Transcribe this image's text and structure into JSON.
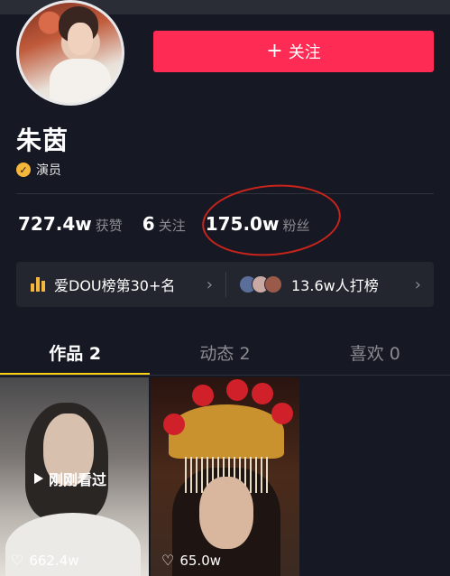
{
  "profile": {
    "follow_label": "关注",
    "name": "朱茵",
    "verify_label": "演员"
  },
  "stats": {
    "likes_value": "727.4w",
    "likes_label": "获赞",
    "following_value": "6",
    "following_label": "关注",
    "fans_value": "175.0w",
    "fans_label": "粉丝"
  },
  "rank": {
    "dou_label": "爱DOU榜第30+名",
    "supporters_label": "13.6w人打榜"
  },
  "tabs": [
    {
      "label": "作品 2",
      "active": true
    },
    {
      "label": "动态 2",
      "active": false
    },
    {
      "label": "喜欢 0",
      "active": false
    }
  ],
  "videos": [
    {
      "badge": "刚刚看过",
      "likes": "662.4w"
    },
    {
      "likes": "65.0w"
    }
  ],
  "colors": {
    "background": "#161823",
    "follow_button": "#fe2c55",
    "tab_indicator": "#face15",
    "verify_badge": "#f5b73b",
    "annotation_circle": "#c7241c"
  },
  "icons": {
    "follow": "plus-icon",
    "verify": "check-badge-icon",
    "rank": "bar-chart-icon",
    "chevron": "chevron-right-icon",
    "play": "play-icon",
    "like": "heart-outline-icon"
  }
}
